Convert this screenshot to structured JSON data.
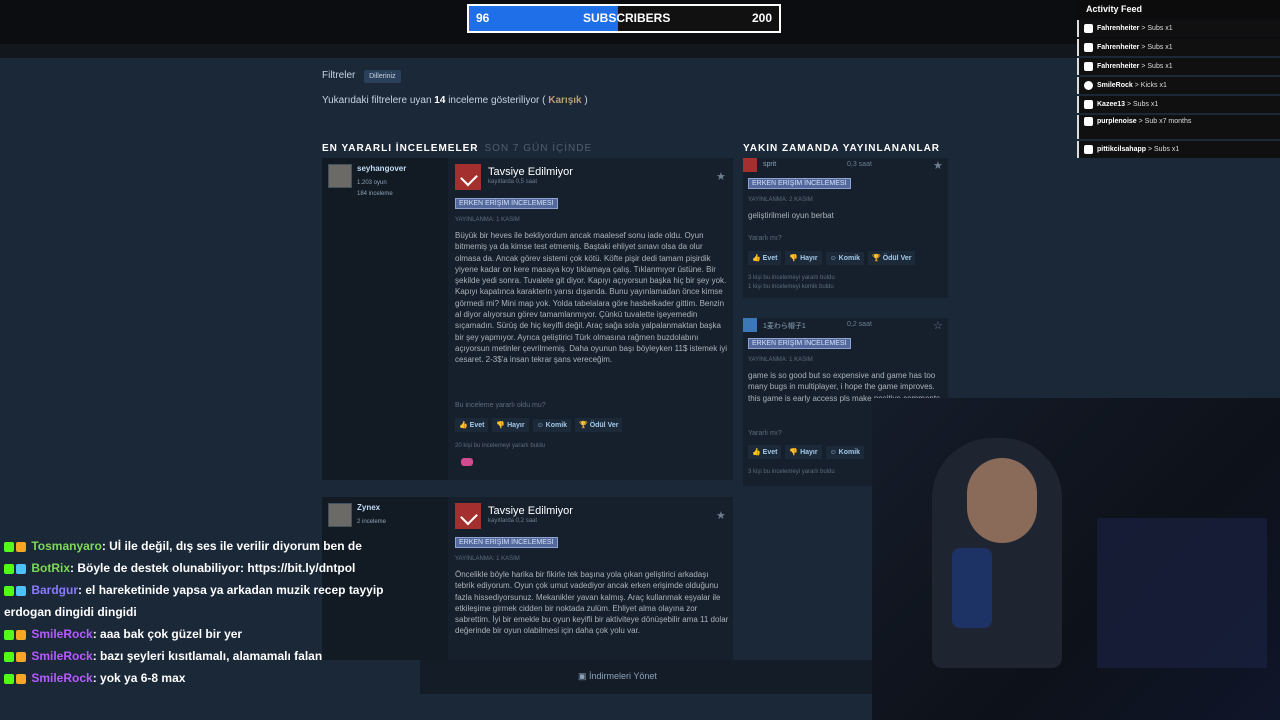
{
  "stream": {
    "sub_goal": {
      "current": "96",
      "label": "SUBSCRIBERS",
      "target": "200",
      "progress": 0.48
    },
    "activity_feed": {
      "title": "Activity Feed",
      "items": [
        {
          "user": "Fahrenheiter",
          "action": "> Subs x1"
        },
        {
          "user": "Fahrenheiter",
          "action": "> Subs x1"
        },
        {
          "user": "Fahrenheiter",
          "action": "> Subs x1"
        },
        {
          "user": "SmileRock",
          "action": "> Kicks x1"
        },
        {
          "user": "Kazee13",
          "action": "> Subs x1"
        },
        {
          "user": "purplenoise",
          "action": "> Sub x7 months"
        },
        {
          "user": "pittikcilsahapp",
          "action": "> Subs x1"
        }
      ]
    },
    "chat": [
      {
        "user": "Tosmanyaro",
        "color": "#7ed957",
        "text": ": Uİ ile değil, dış ses ile verilir diyorum ben de"
      },
      {
        "user": "BotRix",
        "color": "#7ed957",
        "text": ": Böyle de destek olunabiliyor: https://bit.ly/dntpol"
      },
      {
        "user": "Bardgur",
        "color": "#8b7bff",
        "text": ": el hareketinide yapsa ya arkadan muzik recep tayyip erdogan dingidi dingidi"
      },
      {
        "user": "SmileRock",
        "color": "#b55cff",
        "text": ": aaa bak çok güzel bir yer"
      },
      {
        "user": "SmileRock",
        "color": "#b55cff",
        "text": ": bazı şeyleri kısıtlamalı, alamamalı falan"
      },
      {
        "user": "SmileRock",
        "color": "#b55cff",
        "text": ": yok ya 6-8 max"
      }
    ]
  },
  "steam": {
    "filters_label": "Filtreler",
    "filter_chip": "Dilleriniz",
    "showing_prefix": "Yukarıdaki filtrelere uyan",
    "showing_count": "14",
    "showing_mid": "inceleme gösteriliyor (",
    "showing_mixed": "Karışık",
    "showing_end": ")",
    "most_helpful": "EN YARARLI İNCELEMELER",
    "most_helpful_sub": "SON 7 GÜN İÇİNDE",
    "recent": "YAKIN ZAMANDA YAYINLANANLAR",
    "manage_downloads": "İndirmeleri Yönet",
    "reviews": [
      {
        "user": "seyhangover",
        "games": "1.203 oyun",
        "reviews": "184 inceleme",
        "verdict": "Tavsiye Edilmiyor",
        "hours": "kayıtlarda 0,5 saat",
        "badge": "ERKEN ERİŞİM İNCELEMESİ",
        "posted": "YAYINLANMA: 1 KASIM",
        "body": "Büyük bir heves ile bekliyordum ancak maalesef sonu iade oldu. Oyun bitmemiş ya da kimse test etmemiş. Baştaki ehliyet sınavı olsa da olur olmasa da. Ancak görev sistemi çok kötü. Köfte pişir dedi tamam pişirdik yiyene kadar on kere masaya koy tıklamaya çalış. Tıklanmıyor üstüne. Bir şekilde yedi sonra. Tuvalete git diyor. Kapıyı açıyorsun başka hiç bir şey yok. Kapıyı kapatınca karakterin yarısı dışarıda. Bunu yayınlamadan önce kimse görmedi mi? Mini map yok. Yolda tabelalara göre hasbelkader gittim. Benzin al diyor alıyorsun görev tamamlanmıyor. Çünkü tuvalette işeyemedin sıçamadın. Sürüş de hiç keyifli değil. Araç sağa sola yalpalanmaktan başka bir şey yapmıyor. Ayrıca geliştirici Türk olmasına rağmen buzdolabını açıyorsun metinler çevrilmemiş. Daha oyunun başı böyleyken 11$ istemek iyi cesaret. 2-3$'a insan tekrar şans vereceğim.",
        "help_q": "Bu inceleme yararlı oldu mu?",
        "yes": "Evet",
        "no": "Hayır",
        "funny": "Komik",
        "award": "Ödül Ver",
        "found": "20 kişi bu incelemeyi yararlı buldu"
      },
      {
        "user": "Zynex",
        "games": "",
        "reviews": "2 inceleme",
        "verdict": "Tavsiye Edilmiyor",
        "hours": "kayıtlarda 0,2 saat",
        "badge": "ERKEN ERİŞİM İNCELEMESİ",
        "posted": "YAYINLANMA: 1 KASIM",
        "body": "Öncelikle böyle harika bir fikirle tek başına yola çıkan geliştirici arkadaşı tebrik ediyorum. Oyun çok umut vadediyor ancak erken erişimde olduğunu fazla hissediyorsunuz. Mekanikler yavan kalmış. Araç kullanmak eşyalar ile etkileşime girmek cidden bir noktada zulüm. Ehliyet alma olayına zor sabrettim. İyi bir emekle bu oyun keyifli bir aktiviteye dönüşebilir ama 11 dolar değerinde bir oyun olabilmesi için daha çok yolu var."
      }
    ],
    "recent_reviews": [
      {
        "user": "sprit",
        "hours": "0,3 saat",
        "badge": "ERKEN ERİŞİM İNCELEMESİ",
        "posted": "YAYINLANMA: 2 KASIM",
        "body": "geliştirilmeli oyun berbat",
        "help_q": "Yararlı mı?",
        "yes": "Evet",
        "no": "Hayır",
        "funny": "Komik",
        "award": "Ödül Ver",
        "found1": "3 kişi bu incelemeyi yararlı buldu",
        "found2": "1 kişi bu incelemeyi komik buldu"
      },
      {
        "user": "1麦わら帽子1",
        "hours": "0,2 saat",
        "badge": "ERKEN ERİŞİM İNCELEMESİ",
        "posted": "YAYINLANMA: 1 KASIM",
        "body": "game is so good but so expensive and game has too many bugs in multiplayer, i hope the game improves. this game is early access pls make positive comments",
        "help_q": "Yararlı mı?",
        "yes": "Evet",
        "no": "Hayır",
        "funny": "Komik",
        "found1": "3 kişi bu incelemeyi yararlı buldu"
      }
    ]
  }
}
